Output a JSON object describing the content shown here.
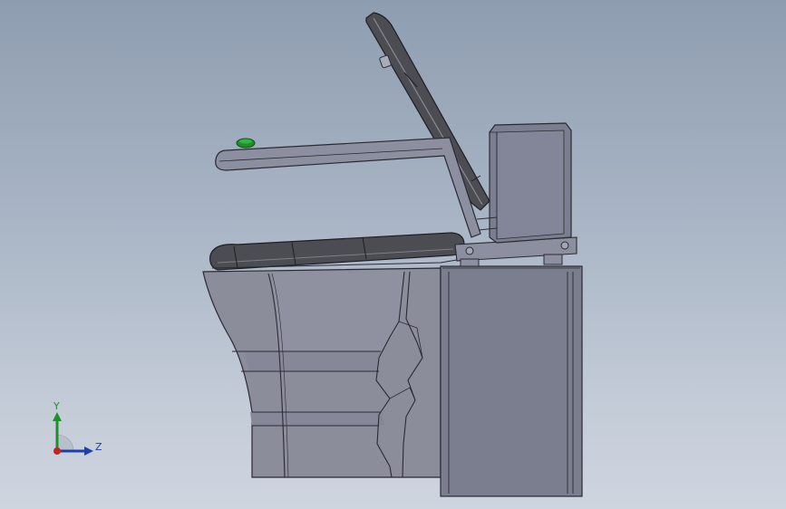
{
  "viewport": {
    "background_top": "#8e9db0",
    "background_bottom": "#ced5df"
  },
  "model": {
    "body_color": "#8a8c9a",
    "edge_color": "#2a2a33",
    "seat_color": "#4a4b50",
    "tank_color": "#7a7d8e",
    "accent_button_color": "#1f8f2a"
  },
  "triad": {
    "y_label": "Y",
    "z_label": "Z",
    "y_axis_color": "#1f8f2a",
    "z_axis_color": "#1f3fb0",
    "x_axis_color": "#c0261e",
    "icon": "coordinate-triad-icon"
  }
}
